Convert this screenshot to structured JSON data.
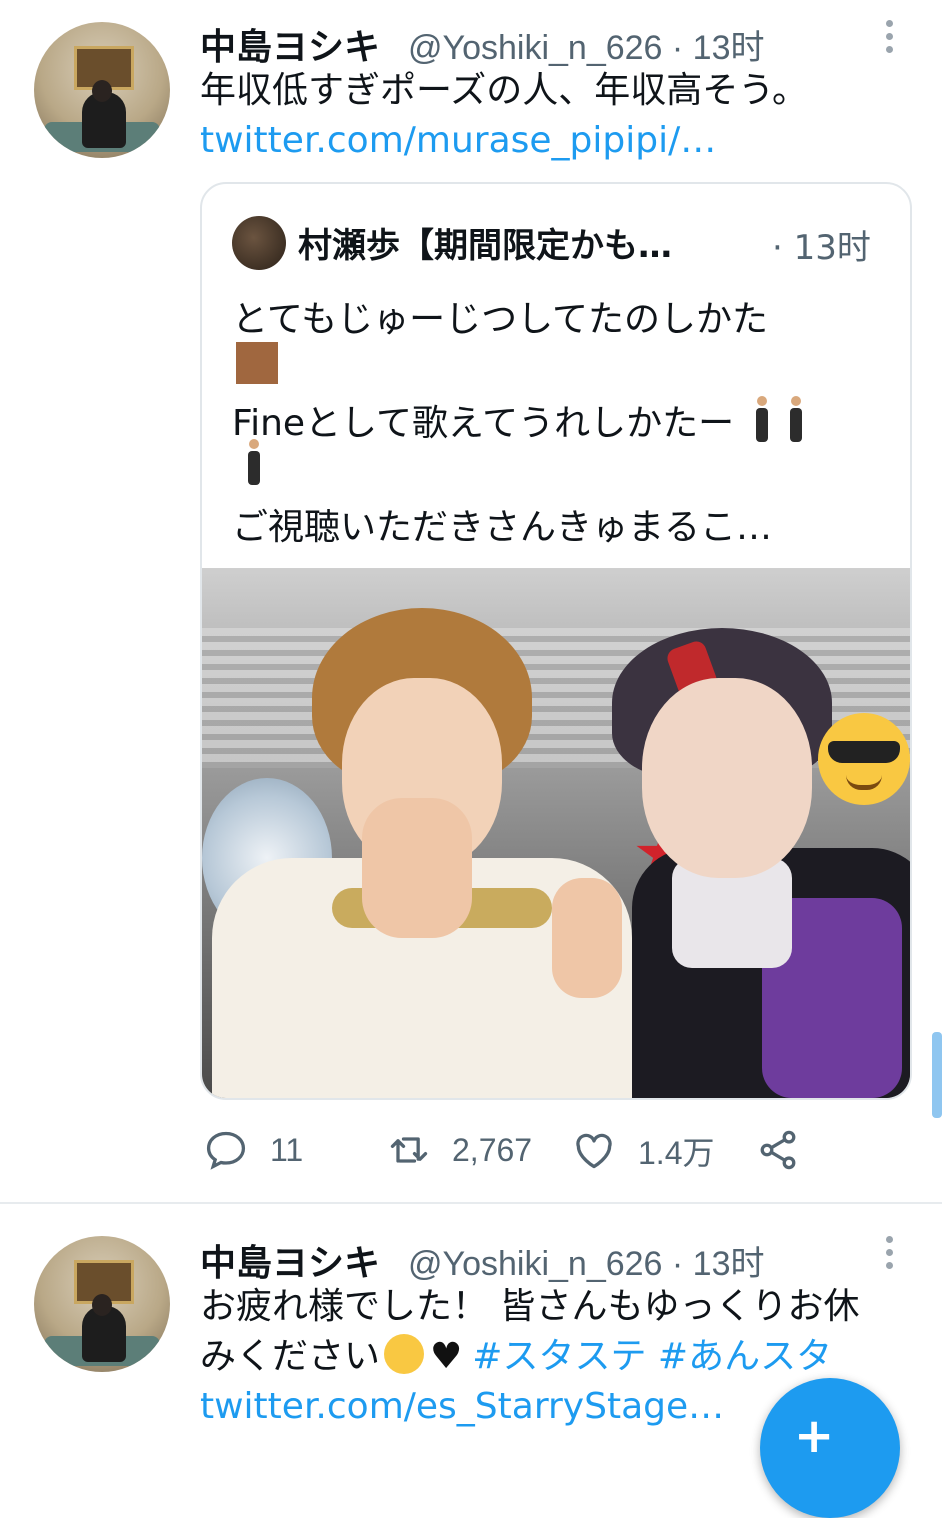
{
  "tweets": [
    {
      "name": "中島ヨシキ",
      "handle": "@Yoshiki_n_626 · 13时",
      "text_lines": [
        "年収低すぎポーズの人、年収高そう。"
      ],
      "link": "twitter.com/murase_pipipi/…",
      "quote": {
        "name": "村瀬歩【期間限定かも…",
        "time": "· 13时",
        "line1": "とてもじゅーじつしてたのしかた",
        "line2": "Fineとして歌えてうれしかたー",
        "line3": "ご視聴いただきさんきゅまるこ…"
      },
      "actions": {
        "reply_count": "11",
        "retweet_count": "2,767",
        "like_count": "1.4万"
      }
    },
    {
      "name": "中島ヨシキ",
      "handle": "@Yoshiki_n_626 · 13时",
      "line1": "お疲れ様でした！ 皆さんもゆっくりお休",
      "line2_text": "みください",
      "hashtags": "#スタステ #あんスタ",
      "link": "twitter.com/es_StarryStage…"
    }
  ],
  "icons": {
    "reply": "reply-icon",
    "retweet": "retweet-icon",
    "like": "heart-icon",
    "share": "share-icon",
    "compose": "compose-icon"
  },
  "colors": {
    "link": "#1d9bf0",
    "secondary": "#536471"
  }
}
